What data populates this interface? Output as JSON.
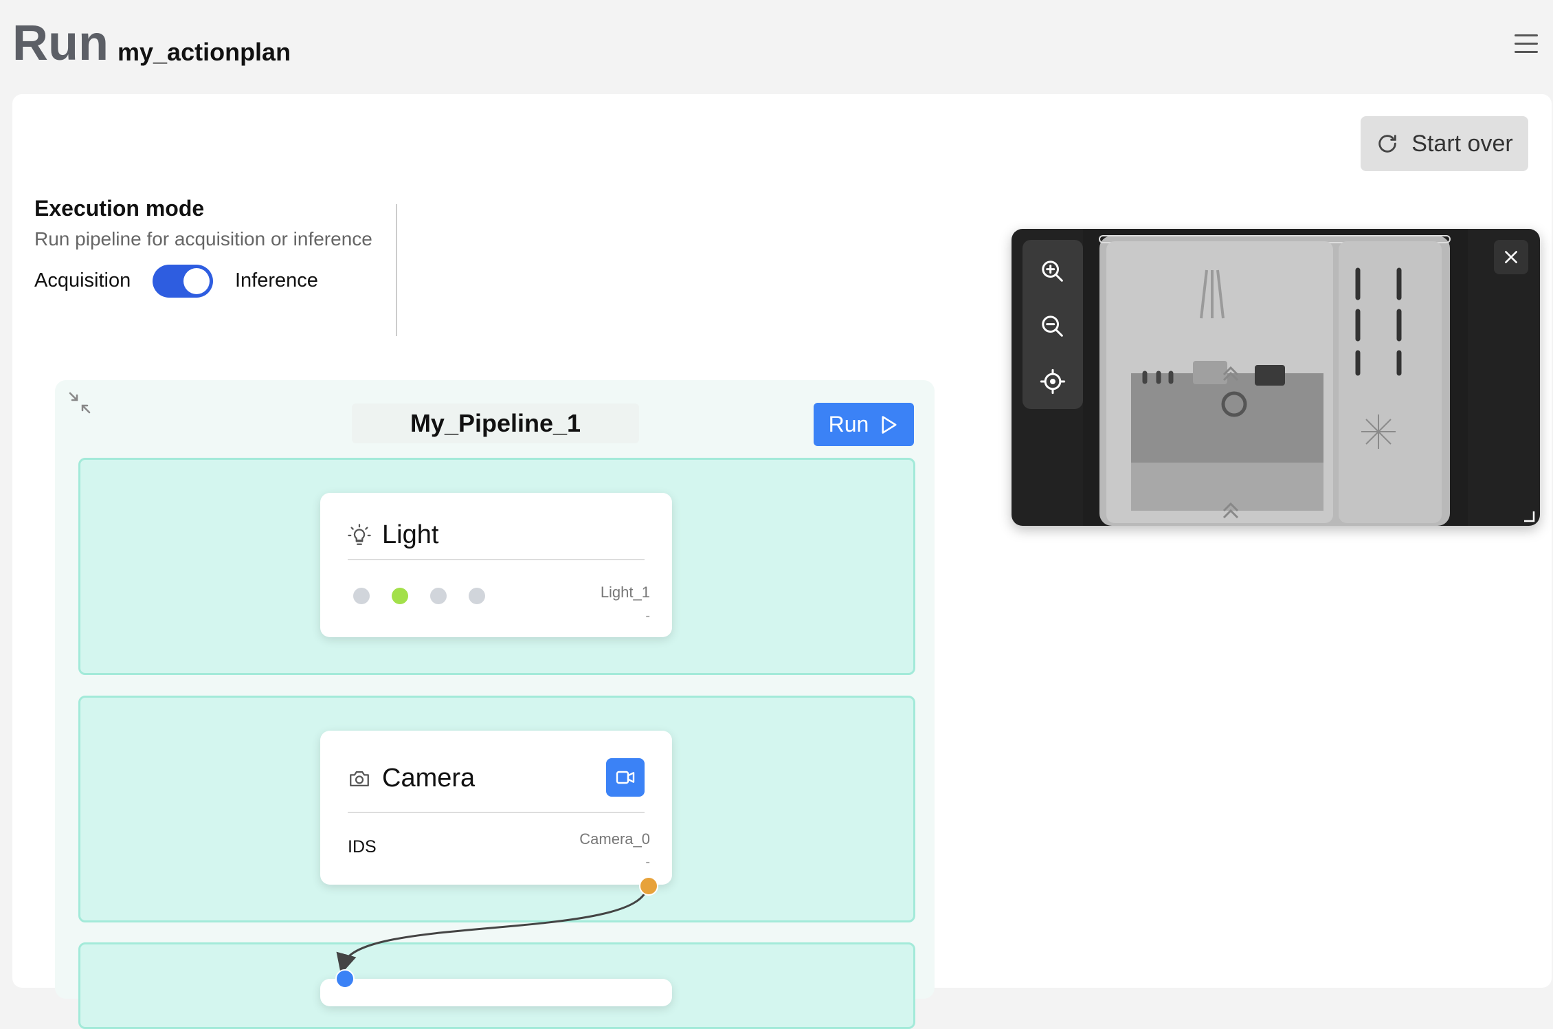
{
  "header": {
    "title": "Run",
    "subtitle": "my_actionplan"
  },
  "icons": {
    "menu": "hamburger-icon",
    "refresh": "refresh-icon",
    "collapse": "collapse-icon",
    "play": "play-icon",
    "bulb": "lightbulb-icon",
    "camera": "camera-icon",
    "video": "video-icon",
    "zoom_in": "zoom-in-icon",
    "zoom_out": "zoom-out-icon",
    "center": "crosshair-icon",
    "close": "close-icon"
  },
  "actions": {
    "start_over": "Start over"
  },
  "execution": {
    "title": "Execution mode",
    "description": "Run pipeline for acquisition or inference",
    "left_label": "Acquisition",
    "right_label": "Inference",
    "toggle_on": true
  },
  "pipeline": {
    "name": "My_Pipeline_1",
    "run_label": "Run",
    "nodes": [
      {
        "title": "Light",
        "id": "Light_1",
        "status": "-",
        "indicators": [
          {
            "color": "#d1d5db"
          },
          {
            "color": "#a3e04a"
          },
          {
            "color": "#d1d5db"
          },
          {
            "color": "#d1d5db"
          }
        ]
      },
      {
        "title": "Camera",
        "id": "Camera_0",
        "status": "-",
        "model": "IDS"
      }
    ]
  },
  "colors": {
    "accent": "#3b82f6",
    "toggle": "#2e5de0",
    "stage_bg": "#d4f6ef",
    "stage_border": "#a3ead9",
    "output_handle": "#e7a23a",
    "input_handle": "#3b82f6"
  }
}
